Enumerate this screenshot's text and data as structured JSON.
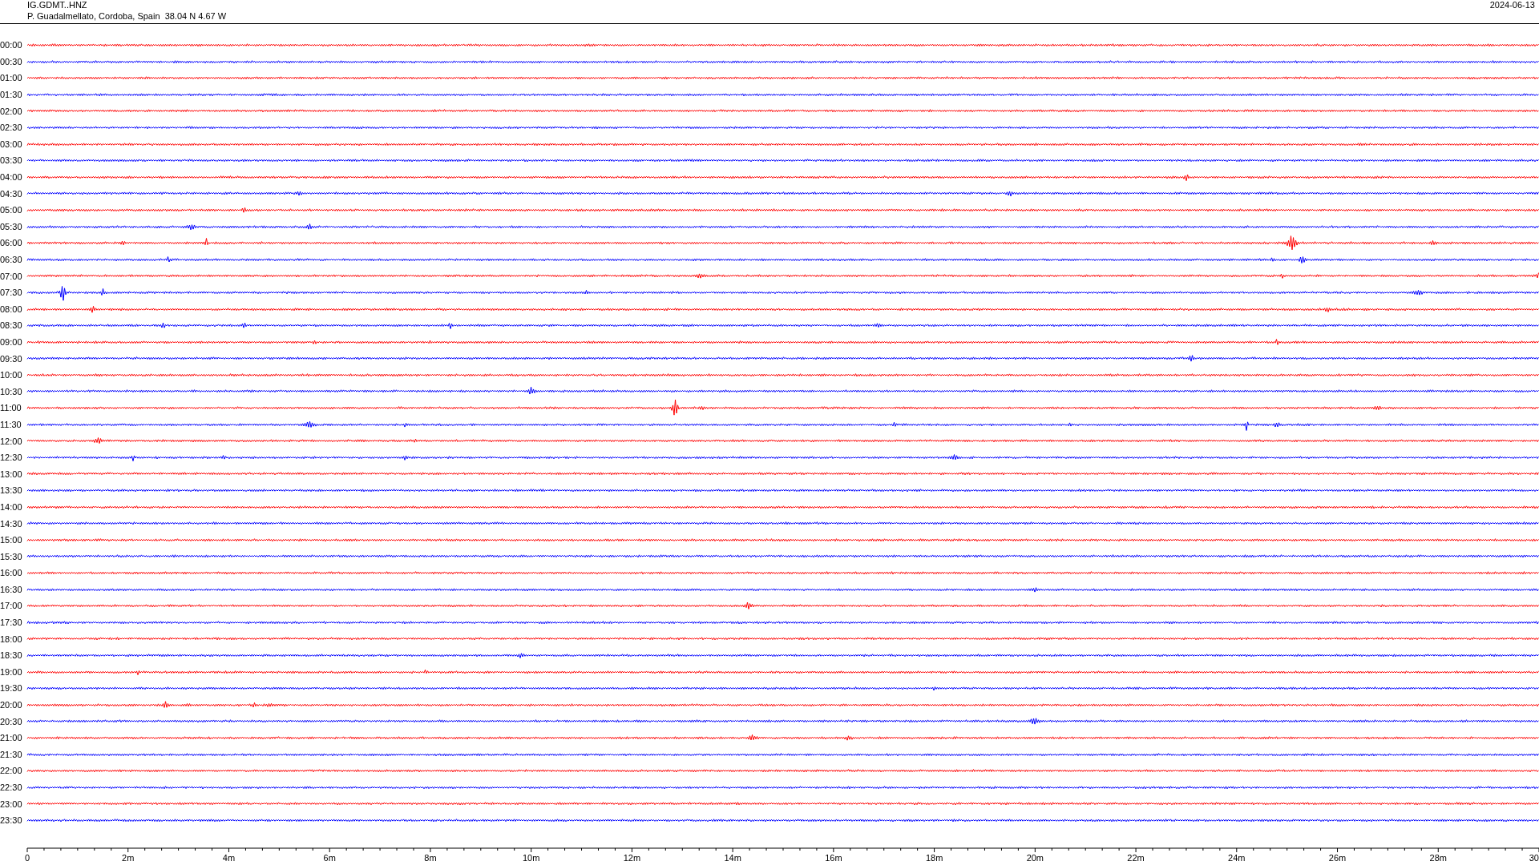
{
  "header": {
    "station": "IG.GDMT..HNZ",
    "location": "P. Guadalmellato, Cordoba, Spain  38.04 N 4.67 W",
    "date": "2024-06-13"
  },
  "rows": [
    {
      "label": "00:00",
      "color": "#ff0000"
    },
    {
      "label": "00:30",
      "color": "#0000ff"
    },
    {
      "label": "01:00",
      "color": "#ff0000"
    },
    {
      "label": "01:30",
      "color": "#0000ff"
    },
    {
      "label": "02:00",
      "color": "#ff0000"
    },
    {
      "label": "02:30",
      "color": "#0000ff"
    },
    {
      "label": "03:00",
      "color": "#ff0000"
    },
    {
      "label": "03:30",
      "color": "#0000ff"
    },
    {
      "label": "04:00",
      "color": "#ff0000"
    },
    {
      "label": "04:30",
      "color": "#0000ff"
    },
    {
      "label": "05:00",
      "color": "#ff0000"
    },
    {
      "label": "05:30",
      "color": "#0000ff"
    },
    {
      "label": "06:00",
      "color": "#ff0000"
    },
    {
      "label": "06:30",
      "color": "#0000ff"
    },
    {
      "label": "07:00",
      "color": "#ff0000"
    },
    {
      "label": "07:30",
      "color": "#0000ff"
    },
    {
      "label": "08:00",
      "color": "#ff0000"
    },
    {
      "label": "08:30",
      "color": "#0000ff"
    },
    {
      "label": "09:00",
      "color": "#ff0000"
    },
    {
      "label": "09:30",
      "color": "#0000ff"
    },
    {
      "label": "10:00",
      "color": "#ff0000"
    },
    {
      "label": "10:30",
      "color": "#0000ff"
    },
    {
      "label": "11:00",
      "color": "#ff0000"
    },
    {
      "label": "11:30",
      "color": "#0000ff"
    },
    {
      "label": "12:00",
      "color": "#ff0000"
    },
    {
      "label": "12:30",
      "color": "#0000ff"
    },
    {
      "label": "13:00",
      "color": "#ff0000"
    },
    {
      "label": "13:30",
      "color": "#0000ff"
    },
    {
      "label": "14:00",
      "color": "#ff0000"
    },
    {
      "label": "14:30",
      "color": "#0000ff"
    },
    {
      "label": "15:00",
      "color": "#ff0000"
    },
    {
      "label": "15:30",
      "color": "#0000ff"
    },
    {
      "label": "16:00",
      "color": "#ff0000"
    },
    {
      "label": "16:30",
      "color": "#0000ff"
    },
    {
      "label": "17:00",
      "color": "#ff0000"
    },
    {
      "label": "17:30",
      "color": "#0000ff"
    },
    {
      "label": "18:00",
      "color": "#ff0000"
    },
    {
      "label": "18:30",
      "color": "#0000ff"
    },
    {
      "label": "19:00",
      "color": "#ff0000"
    },
    {
      "label": "19:30",
      "color": "#0000ff"
    },
    {
      "label": "20:00",
      "color": "#ff0000"
    },
    {
      "label": "20:30",
      "color": "#0000ff"
    },
    {
      "label": "21:00",
      "color": "#ff0000"
    },
    {
      "label": "21:30",
      "color": "#0000ff"
    },
    {
      "label": "22:00",
      "color": "#ff0000"
    },
    {
      "label": "22:30",
      "color": "#0000ff"
    },
    {
      "label": "23:00",
      "color": "#ff0000"
    },
    {
      "label": "23:30",
      "color": "#0000ff"
    }
  ],
  "x_axis": {
    "ticks": [
      "0",
      "2m",
      "4m",
      "6m",
      "8m",
      "10m",
      "12m",
      "14m",
      "16m",
      "18m",
      "20m",
      "22m",
      "24m",
      "26m",
      "28m",
      "30"
    ]
  }
}
